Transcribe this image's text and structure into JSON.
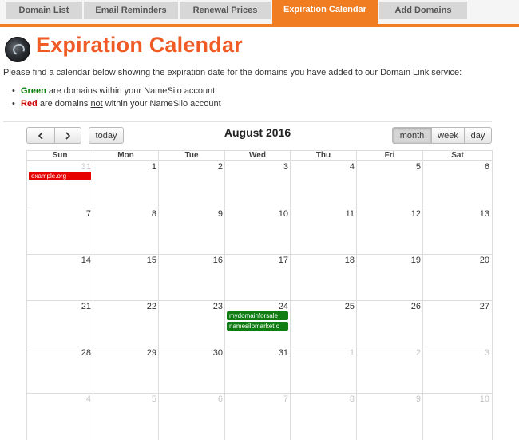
{
  "nav": {
    "tabs": [
      "Domain List",
      "Email Reminders",
      "Renewal Prices",
      "Expiration Calendar",
      "Add Domains"
    ],
    "active_tab": "Expiration Calendar",
    "accent_color": "#f07d22"
  },
  "header": {
    "title": "Expiration Calendar",
    "logo_icon": "globe-icon"
  },
  "intro_text": "Please find a calendar below showing the expiration date for the domains you have added to our Domain Link service:",
  "legend": {
    "green": {
      "label": "Green",
      "text": " are domains within your NameSilo account",
      "color": "#0b7d0b"
    },
    "red": {
      "label": "Red",
      "text_before": " are domains ",
      "not_word": "not",
      "text_after": " within your NameSilo account",
      "color": "#cc0000"
    }
  },
  "calendar": {
    "title": "August 2016",
    "today_label": "today",
    "view_buttons": [
      "month",
      "week",
      "day"
    ],
    "active_view": "month",
    "weekdays": [
      "Sun",
      "Mon",
      "Tue",
      "Wed",
      "Thu",
      "Fri",
      "Sat"
    ],
    "weeks": [
      [
        {
          "d": "31",
          "other": true
        },
        {
          "d": "1"
        },
        {
          "d": "2"
        },
        {
          "d": "3"
        },
        {
          "d": "4"
        },
        {
          "d": "5"
        },
        {
          "d": "6"
        }
      ],
      [
        {
          "d": "7"
        },
        {
          "d": "8"
        },
        {
          "d": "9"
        },
        {
          "d": "10"
        },
        {
          "d": "11"
        },
        {
          "d": "12"
        },
        {
          "d": "13"
        }
      ],
      [
        {
          "d": "14"
        },
        {
          "d": "15"
        },
        {
          "d": "16"
        },
        {
          "d": "17"
        },
        {
          "d": "18"
        },
        {
          "d": "19"
        },
        {
          "d": "20"
        }
      ],
      [
        {
          "d": "21"
        },
        {
          "d": "22"
        },
        {
          "d": "23"
        },
        {
          "d": "24"
        },
        {
          "d": "25"
        },
        {
          "d": "26"
        },
        {
          "d": "27"
        }
      ],
      [
        {
          "d": "28"
        },
        {
          "d": "29"
        },
        {
          "d": "30"
        },
        {
          "d": "31"
        },
        {
          "d": "1",
          "other": true
        },
        {
          "d": "2",
          "other": true
        },
        {
          "d": "3",
          "other": true
        }
      ],
      [
        {
          "d": "4",
          "other": true
        },
        {
          "d": "5",
          "other": true
        },
        {
          "d": "6",
          "other": true
        },
        {
          "d": "7",
          "other": true
        },
        {
          "d": "8",
          "other": true
        },
        {
          "d": "9",
          "other": true
        },
        {
          "d": "10",
          "other": true
        }
      ]
    ],
    "events": [
      {
        "name": "example.org",
        "week": 0,
        "day": 0,
        "color": "red"
      },
      {
        "name": "mydomainforsale",
        "week": 3,
        "day": 3,
        "color": "green"
      },
      {
        "name": "namesilomarket.c",
        "week": 3,
        "day": 3,
        "color": "green"
      }
    ]
  }
}
